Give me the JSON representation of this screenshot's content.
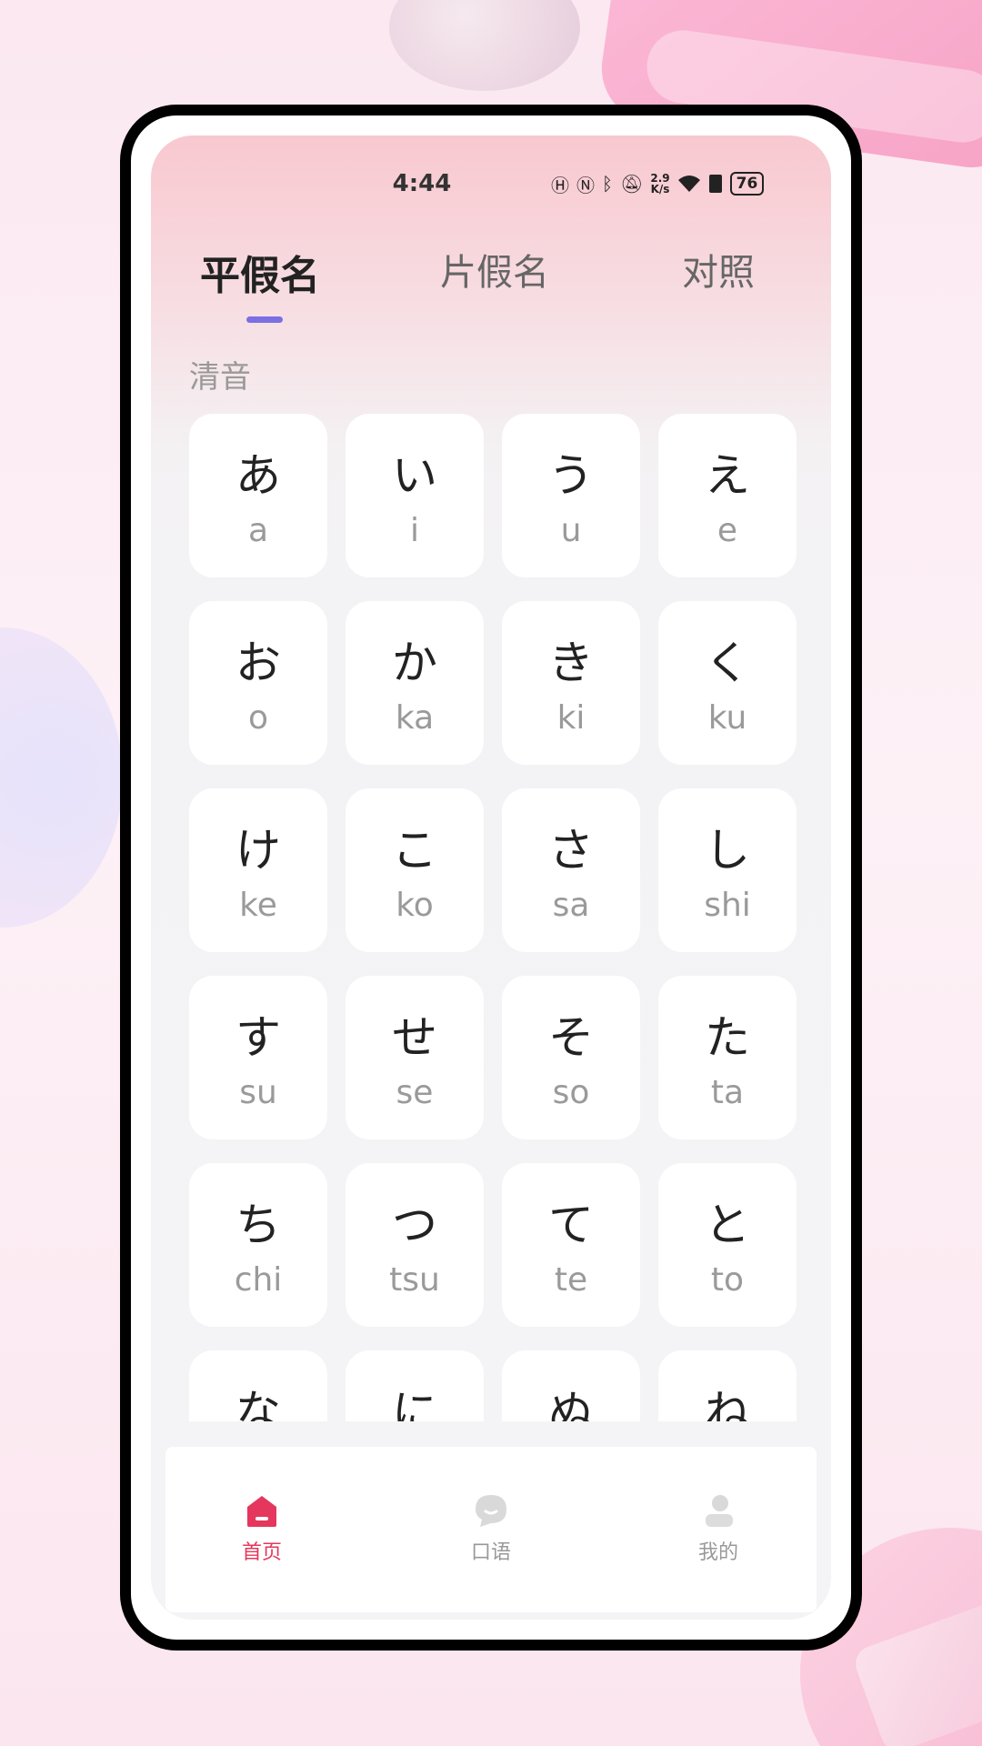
{
  "status_bar": {
    "time": "4:44",
    "speed_top": "2.9",
    "speed_bottom": "K/s",
    "battery": "76"
  },
  "tabs": [
    {
      "label": "平假名",
      "active": true
    },
    {
      "label": "片假名",
      "active": false
    },
    {
      "label": "对照",
      "active": false
    }
  ],
  "section": {
    "title": "清音"
  },
  "cards": [
    {
      "kana": "あ",
      "romaji": "a"
    },
    {
      "kana": "い",
      "romaji": "i"
    },
    {
      "kana": "う",
      "romaji": "u"
    },
    {
      "kana": "え",
      "romaji": "e"
    },
    {
      "kana": "お",
      "romaji": "o"
    },
    {
      "kana": "か",
      "romaji": "ka"
    },
    {
      "kana": "き",
      "romaji": "ki"
    },
    {
      "kana": "く",
      "romaji": "ku"
    },
    {
      "kana": "け",
      "romaji": "ke"
    },
    {
      "kana": "こ",
      "romaji": "ko"
    },
    {
      "kana": "さ",
      "romaji": "sa"
    },
    {
      "kana": "し",
      "romaji": "shi"
    },
    {
      "kana": "す",
      "romaji": "su"
    },
    {
      "kana": "せ",
      "romaji": "se"
    },
    {
      "kana": "そ",
      "romaji": "so"
    },
    {
      "kana": "た",
      "romaji": "ta"
    },
    {
      "kana": "ち",
      "romaji": "chi"
    },
    {
      "kana": "つ",
      "romaji": "tsu"
    },
    {
      "kana": "て",
      "romaji": "te"
    },
    {
      "kana": "と",
      "romaji": "to"
    },
    {
      "kana": "な",
      "romaji": ""
    },
    {
      "kana": "に",
      "romaji": ""
    },
    {
      "kana": "ぬ",
      "romaji": ""
    },
    {
      "kana": "ね",
      "romaji": ""
    }
  ],
  "bottom_nav": [
    {
      "label": "首页",
      "icon": "home-icon",
      "active": true
    },
    {
      "label": "口语",
      "icon": "chat-bubble-icon",
      "active": false
    },
    {
      "label": "我的",
      "icon": "profile-icon",
      "active": false
    }
  ],
  "colors": {
    "accent": "#e5365d",
    "tab_indicator": "#7b6fe3"
  }
}
